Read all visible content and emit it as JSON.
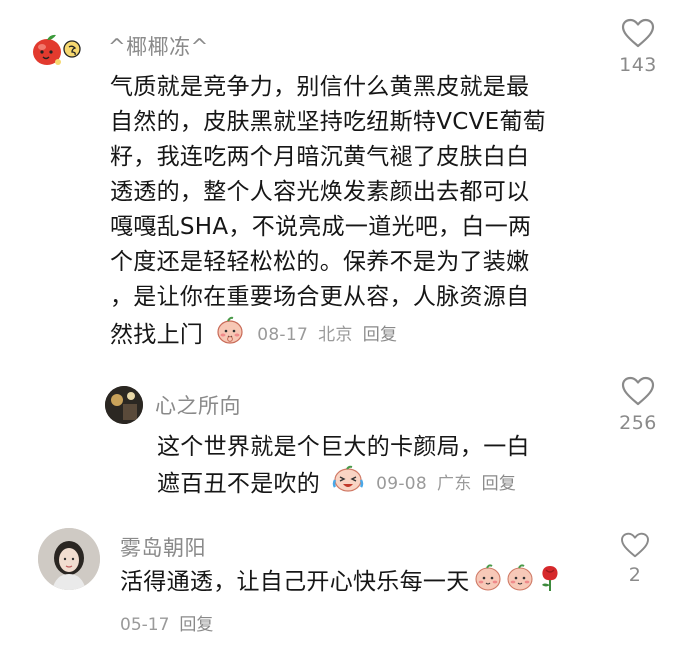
{
  "comments": [
    {
      "username": "^椰椰冻^",
      "lines": [
        "气质就是竞争力，别信什么黄黑皮就是最",
        "自然的，皮肤黑就坚持吃纽斯特VCVE葡萄",
        "籽，我连吃两个月暗沉黄气褪了皮肤白白",
        "透透的，整个人容光焕发素颜出去都可以",
        "嘎嘎乱SHA，不说亮成一道光吧，白一两",
        "个度还是轻轻松松的。保养不是为了装嫩",
        "，是让你在重要场合更从容，人脉资源自",
        "然找上门"
      ],
      "date": "08-17",
      "location": "北京",
      "reply_label": "回复",
      "likes": "143",
      "icons": [
        "apple-avatar-icon",
        "shy-face-icon",
        "heart-outline-icon"
      ]
    },
    {
      "username": "心之所向",
      "lines": [
        "这个世界就是个巨大的卡颜局，一白",
        "遮百丑不是吹的"
      ],
      "date": "09-08",
      "location": "广东",
      "reply_label": "回复",
      "likes": "256",
      "icons": [
        "laugh-cry-face-icon",
        "heart-outline-icon"
      ]
    },
    {
      "username": "雾岛朝阳",
      "lines": [
        "活得通透，让自己开心快乐每一天"
      ],
      "date": "05-17",
      "reply_label": "回复",
      "likes": "2",
      "icons": [
        "peach-face-icon",
        "peach-face-icon",
        "rose-icon",
        "heart-outline-icon"
      ]
    }
  ]
}
